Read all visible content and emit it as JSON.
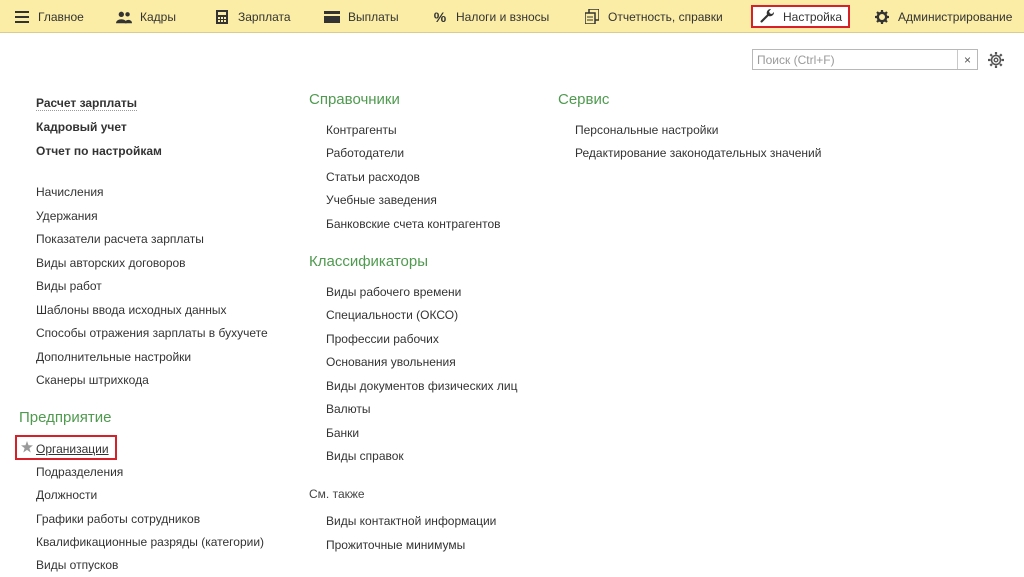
{
  "tabs": [
    {
      "id": "main",
      "label": "Главное",
      "icon": "hamburger-icon"
    },
    {
      "id": "personnel",
      "label": "Кадры",
      "icon": "people-icon"
    },
    {
      "id": "salary",
      "label": "Зарплата",
      "icon": "calculator-icon"
    },
    {
      "id": "payments",
      "label": "Выплаты",
      "icon": "wallet-icon"
    },
    {
      "id": "taxes",
      "label": "Налоги и взносы",
      "icon": "percent-icon"
    },
    {
      "id": "reports",
      "label": "Отчетность, справки",
      "icon": "documents-icon"
    },
    {
      "id": "settings",
      "label": "Настройка",
      "icon": "wrench-icon",
      "active": true
    },
    {
      "id": "admin",
      "label": "Администрирование",
      "icon": "gear-icon"
    }
  ],
  "search": {
    "placeholder": "Поиск (Ctrl+F)",
    "value": "",
    "clear_label": "×"
  },
  "left": {
    "top_items": [
      "Расчет зарплаты",
      "Кадровый учет",
      "Отчет по настройкам"
    ],
    "items": [
      "Начисления",
      "Удержания",
      "Показатели расчета зарплаты",
      "Виды авторских договоров",
      "Виды работ",
      "Шаблоны ввода исходных данных",
      "Способы отражения зарплаты в бухучете",
      "Дополнительные настройки",
      "Сканеры штрихкода"
    ],
    "enterprise_heading": "Предприятие",
    "enterprise_items": [
      "Организации",
      "Подразделения",
      "Должности",
      "Графики работы сотрудников",
      "Квалификационные разряды (категории)",
      "Виды отпусков"
    ]
  },
  "middle": {
    "directories_heading": "Справочники",
    "directories": [
      "Контрагенты",
      "Работодатели",
      "Статьи расходов",
      "Учебные заведения",
      "Банковские счета контрагентов"
    ],
    "classifiers_heading": "Классификаторы",
    "classifiers": [
      "Виды рабочего времени",
      "Специальности (ОКСО)",
      "Профессии рабочих",
      "Основания увольнения",
      "Виды документов физических лиц",
      "Валюты",
      "Банки",
      "Виды справок"
    ],
    "see_also_heading": "См. также",
    "see_also": [
      "Виды контактной информации",
      "Прожиточные минимумы"
    ]
  },
  "right": {
    "service_heading": "Сервис",
    "service": [
      "Персональные настройки",
      "Редактирование законодательных значений"
    ]
  },
  "colors": {
    "topbar": "#fbeda5",
    "heading": "#4f9a4f",
    "highlight": "#d6202a"
  }
}
